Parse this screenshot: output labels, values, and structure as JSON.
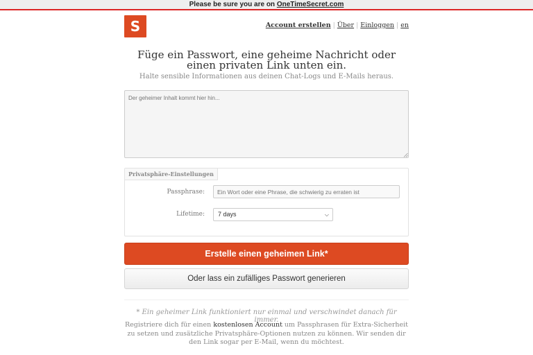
{
  "banner": {
    "prefix": "Please be sure you are on ",
    "site": "OneTimeSecret.com"
  },
  "logo": {
    "letter": "S",
    "color": "#dd4a22"
  },
  "nav": {
    "create_account": "Account erstellen",
    "about": "Über",
    "login": "Einloggen",
    "language": "en",
    "separator": "|"
  },
  "header": {
    "headline": "Füge ein Passwort, eine geheime Nachricht oder einen privaten Link unten ein.",
    "subline": "Halte sensible Informationen aus deinen Chat-Logs und E-Mails heraus."
  },
  "secret": {
    "placeholder": "Der geheimer Inhalt kommt hier hin..."
  },
  "privacy": {
    "legend": "Privatsphäre-Einstellungen",
    "passphrase_label": "Passphrase:",
    "passphrase_placeholder": "Ein Wort oder eine Phrase, die schwierig zu erraten ist",
    "lifetime_label": "Lifetime:",
    "lifetime_value": "7 days"
  },
  "actions": {
    "create_link": "Erstelle einen geheimen Link*",
    "generate_password": "Oder lass ein zufälliges Passwort generieren"
  },
  "footer": {
    "note": "* Ein geheimer Link funktioniert nur einmal und verschwindet danach für immer.",
    "register_before": "Registriere dich für einen ",
    "register_link": "kostenlosen Account",
    "register_after": " um Passphrasen für Extra-Sicherheit zu setzen und zusätzliche Privatsphäre-Optionen nutzen zu können. Wir senden dir den Link sogar per E-Mail, wenn du möchtest."
  },
  "colors": {
    "accent": "#dd4a22",
    "banner_border": "#dc2626"
  }
}
